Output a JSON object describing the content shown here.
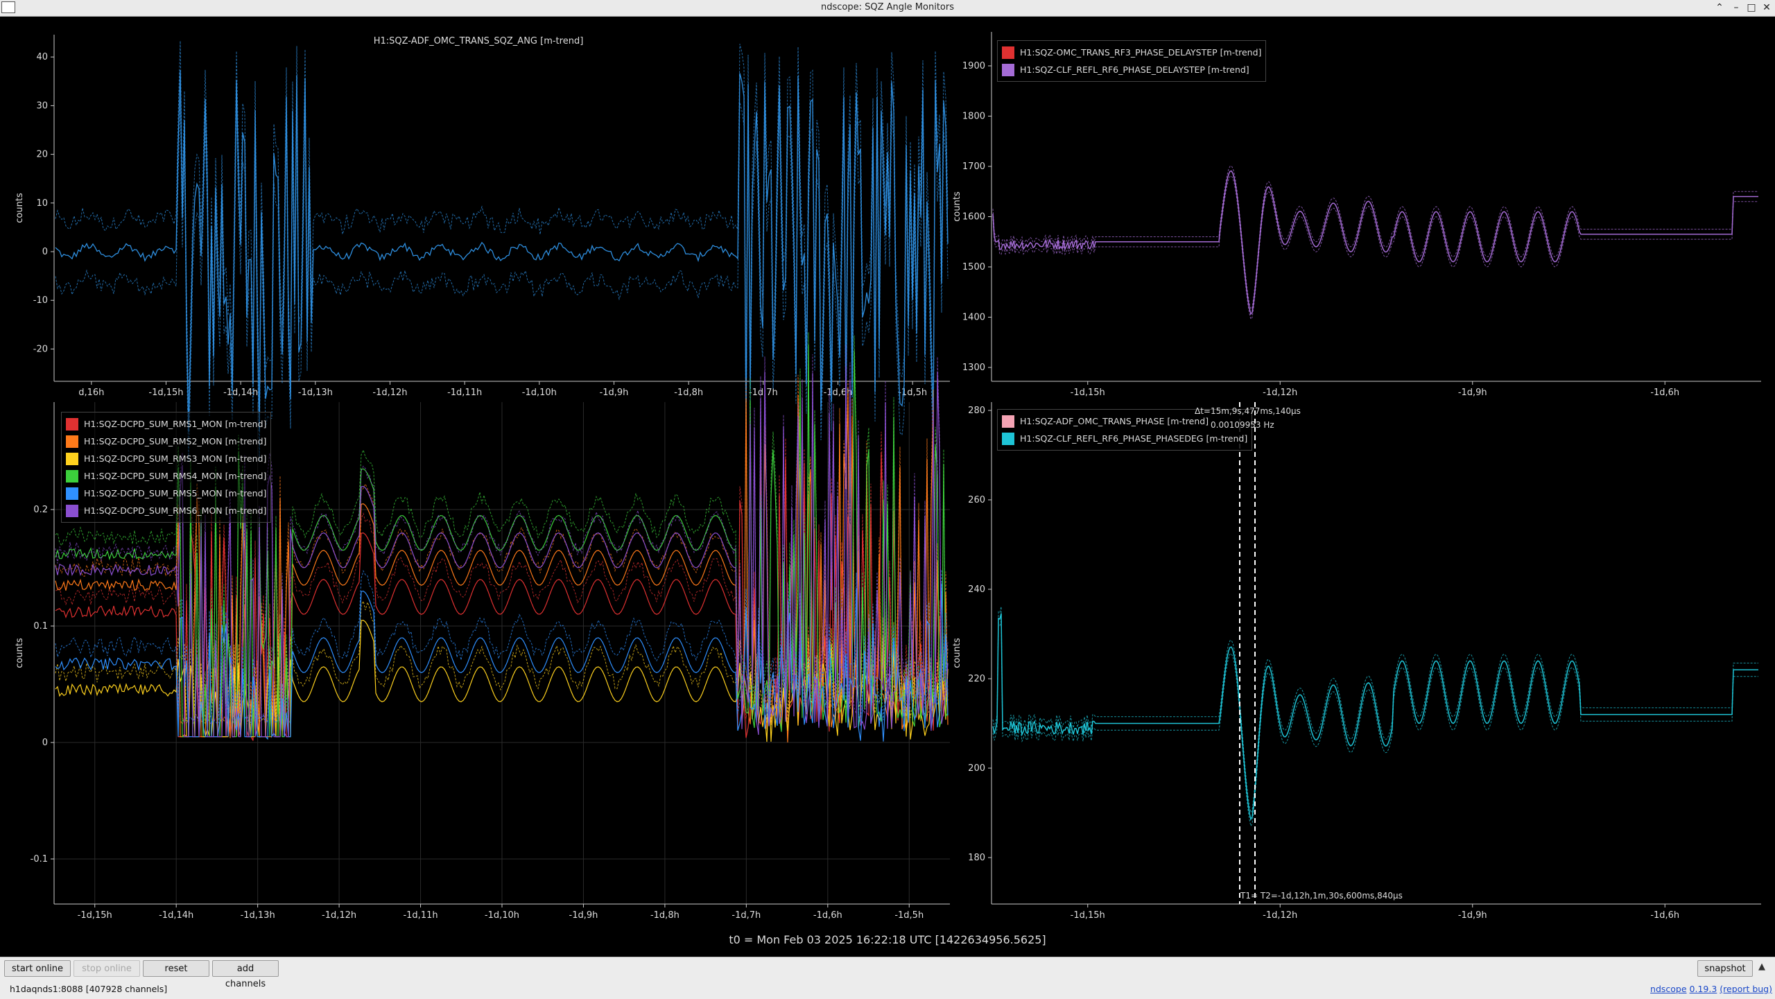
{
  "window": {
    "title": "ndscope: SQZ Angle Monitors",
    "controls": [
      "⌃",
      "–",
      "□",
      "✕"
    ]
  },
  "colors": {
    "background": "#000000",
    "grid": "#2a2a2a",
    "axis": "#cccccc",
    "blue": "#2e8fe0",
    "red": "#e03131",
    "orange": "#ff7a1a",
    "yellow": "#ffd21e",
    "green": "#3ccf3c",
    "lightblue": "#2f90ff",
    "purple": "#8a4fd0",
    "violet": "#a56cd6",
    "pink": "#f4a3b4",
    "cyan": "#1ec4d6"
  },
  "plots": {
    "sqz_ang": {
      "title": "H1:SQZ-ADF_OMC_TRANS_SQZ_ANG [m-trend]",
      "ylabel": "counts",
      "yticks": [
        "40",
        "30",
        "20",
        "10",
        "0",
        "-10",
        "-20"
      ],
      "xticks": [
        "d,16h",
        "-1d,15h",
        "-1d,14h",
        "-1d,13h",
        "-1d,12h",
        "-1d,11h",
        "-1d,10h",
        "-1d,9h",
        "-1d,8h",
        "-1d,7h",
        "-1d,6h",
        "-1d,5h"
      ]
    },
    "delaystep": {
      "ylabel": "counts",
      "yticks": [
        "1900",
        "1800",
        "1700",
        "1600",
        "1500",
        "1400",
        "1300"
      ],
      "xticks": [
        "-1d,15h",
        "-1d,12h",
        "-1d,9h",
        "-1d,6h"
      ],
      "legend": [
        {
          "label": "H1:SQZ-OMC_TRANS_RF3_PHASE_DELAYSTEP [m-trend]",
          "color": "#e03131"
        },
        {
          "label": "H1:SQZ-CLF_REFL_RF6_PHASE_DELAYSTEP [m-trend]",
          "color": "#a56cd6"
        }
      ]
    },
    "rms": {
      "ylabel": "counts",
      "yticks": [
        "0.2",
        "0.1",
        "0",
        "-0.1"
      ],
      "xticks": [
        "-1d,15h",
        "-1d,14h",
        "-1d,13h",
        "-1d,12h",
        "-1d,11h",
        "-1d,10h",
        "-1d,9h",
        "-1d,8h",
        "-1d,7h",
        "-1d,6h",
        "-1d,5h"
      ],
      "legend": [
        {
          "label": "H1:SQZ-DCPD_SUM_RMS1_MON [m-trend]",
          "color": "#e03131"
        },
        {
          "label": "H1:SQZ-DCPD_SUM_RMS2_MON [m-trend]",
          "color": "#ff7a1a"
        },
        {
          "label": "H1:SQZ-DCPD_SUM_RMS3_MON [m-trend]",
          "color": "#ffd21e"
        },
        {
          "label": "H1:SQZ-DCPD_SUM_RMS4_MON [m-trend]",
          "color": "#3ccf3c"
        },
        {
          "label": "H1:SQZ-DCPD_SUM_RMS5_MON [m-trend]",
          "color": "#2f90ff"
        },
        {
          "label": "H1:SQZ-DCPD_SUM_RMS6_MON [m-trend]",
          "color": "#8a4fd0"
        }
      ]
    },
    "phase": {
      "ylabel": "counts",
      "yticks": [
        "280",
        "260",
        "240",
        "220",
        "200",
        "180"
      ],
      "xticks": [
        "-1d,15h",
        "-1d,12h",
        "-1d,9h",
        "-1d,6h"
      ],
      "legend": [
        {
          "label": "H1:SQZ-ADF_OMC_TRANS_PHASE [m-trend]",
          "color": "#f4a3b4"
        },
        {
          "label": "H1:SQZ-CLF_REFL_RF6_PHASE_PHASEDEG [m-trend]",
          "color": "#1ec4d6"
        }
      ],
      "cursor": {
        "delta_label": "Δt=",
        "delta_time": "15m,9s,477ms,140μs",
        "delta_freq": "0.00109953 Hz",
        "t_label": "T1= T2=-1d,12h,1m,30s,600ms,840μs"
      }
    }
  },
  "t0": "t0 = Mon Feb 03 2025 16:22:18 UTC [1422634956.5625]",
  "toolbar": {
    "start_online": "start online",
    "stop_online": "stop online",
    "reset": "reset",
    "add_channels": "add channels",
    "snapshot": "snapshot",
    "expand_glyph": "▲"
  },
  "status": {
    "server": "h1daqnds1:8088  [407928 channels]",
    "app_name": "ndscope",
    "version": "0.19.3",
    "report": "(report bug)"
  }
}
